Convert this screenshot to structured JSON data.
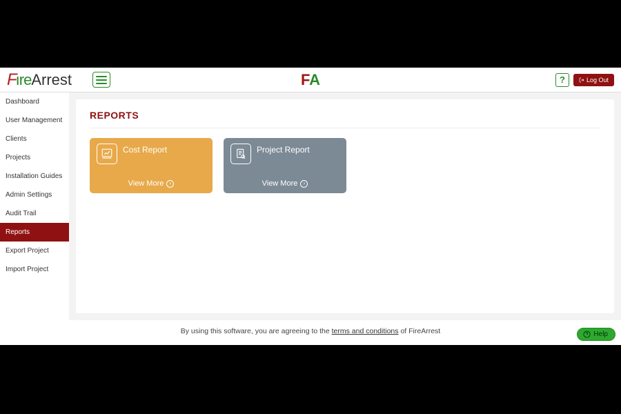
{
  "header": {
    "brand_prefix": "F",
    "brand_re": "ıre",
    "brand_suffix": "Arrest",
    "mini_f": "F",
    "mini_a": "A",
    "logout_label": "Log Out"
  },
  "sidebar": {
    "items": [
      {
        "label": "Dashboard",
        "active": false
      },
      {
        "label": "User Management",
        "active": false
      },
      {
        "label": "Clients",
        "active": false
      },
      {
        "label": "Projects",
        "active": false
      },
      {
        "label": "Installation Guides",
        "active": false
      },
      {
        "label": "Admin Settings",
        "active": false
      },
      {
        "label": "Audit Trail",
        "active": false
      },
      {
        "label": "Reports",
        "active": true
      },
      {
        "label": "Export Project",
        "active": false
      },
      {
        "label": "Import Project",
        "active": false
      }
    ]
  },
  "page": {
    "title": "REPORTS"
  },
  "reports": [
    {
      "title": "Cost Report",
      "color": "orange",
      "view_more": "View More"
    },
    {
      "title": "Project Report",
      "color": "gray",
      "view_more": "View More"
    }
  ],
  "footer": {
    "prefix": "By using this software, you are agreeing to the ",
    "link": "terms and conditions",
    "suffix": " of FireArrest"
  },
  "help_widget": {
    "label": "Help"
  }
}
